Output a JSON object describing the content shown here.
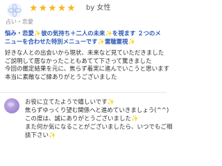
{
  "review": {
    "rating": 5,
    "stars": [
      "★",
      "★",
      "★",
      "★",
      "★"
    ],
    "reviewer": "by 女性",
    "category": "占い・恋愛",
    "menu": {
      "part1": "悩み・恋愛",
      "spark1": "✨",
      "part2": "彼の気持ち＋二人の未来",
      "spark2": "✨",
      "part3": "を視ます",
      "line2": "２つのメニューを合わせた特別メニューです",
      "spark3": "✨",
      "part4": "霊聴霊視",
      "spark4": "✨"
    },
    "body_lines": [
      "好きな人との出会いから現状、未来など見ていただきました",
      "ご説明して居なかったこともあてて下さって驚きました",
      "今回の鑑定結果を元に、焦らず着実に進んでいこうと思います",
      "本当に素敵なご縁ありがとうございました"
    ]
  },
  "reply": {
    "line1": "お役に立てたようで嬉しいです",
    "line1_spark": "✨",
    "line2": "焦らずゆっくり望む関係へと進めていきましょう(^^)",
    "line3": "この度は、誠にありがとうございました",
    "line3_spark": "✨",
    "line4": "また何か気になることがございましたら、いつでもご相",
    "line5": "談下さい",
    "line5_spark": "✨"
  },
  "colors": {
    "star": "#f5b81f",
    "menu_link": "#2a59b8",
    "sparkle": "#f2b324"
  }
}
